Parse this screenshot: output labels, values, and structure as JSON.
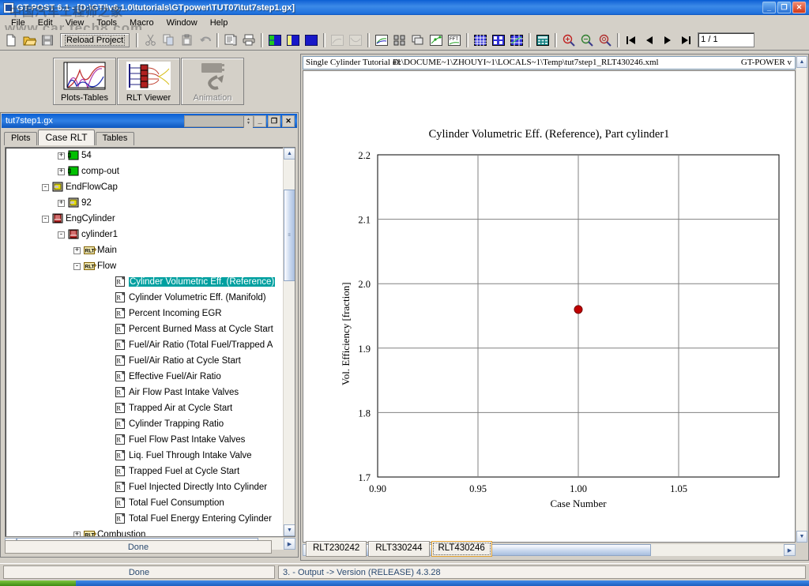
{
  "window": {
    "title": "GT-POST 6.1 - [D:\\GTI\\v6.1.0\\tutorials\\GTpower\\TUT07\\tut7step1.gx]",
    "minimize": "_",
    "maximize": "❐",
    "close": "✕",
    "icon": "app-icon"
  },
  "watermark": {
    "line1": "中国汽车工程师之家",
    "line2": "www.car tech8.com"
  },
  "menu": [
    "File",
    "Edit",
    "View",
    "Tools",
    "Macro",
    "Window",
    "Help"
  ],
  "toolbar": {
    "reload_label": "Reload Project",
    "page_value": "1 / 1",
    "icons": [
      "new-file-icon",
      "open-folder-icon",
      "save-icon",
      "cut-icon",
      "copy-icon",
      "paste-icon",
      "undo-icon",
      "print-preview-icon",
      "print-icon",
      "layout-2x-icon",
      "layout-split-icon",
      "layout-full-icon",
      "plot-disabled-icon",
      "curve-disabled-icon",
      "plot-icon",
      "thumbnails-icon",
      "cascade-icon",
      "xy-plot-icon",
      "fft-icon",
      "table-grid-icon",
      "table-cells-icon",
      "table-plot-icon",
      "calc-icon",
      "zoom-in-icon",
      "zoom-out-icon",
      "zoom-reset-icon",
      "first-page-icon",
      "prev-page-icon",
      "next-page-icon",
      "last-page-icon"
    ]
  },
  "modes": [
    {
      "label": "Plots-Tables",
      "icon": "plots-tables-icon",
      "enabled": true
    },
    {
      "label": "RLT Viewer",
      "icon": "rlt-viewer-icon",
      "enabled": true
    },
    {
      "label": "Animation",
      "icon": "animation-icon",
      "enabled": false
    }
  ],
  "child_window": {
    "title": "tut7step1.gx",
    "minimize": "_",
    "maximize": "❐",
    "close": "✕",
    "tabs": [
      {
        "label": "Plots",
        "active": false
      },
      {
        "label": "Case RLT",
        "active": true
      },
      {
        "label": "Tables",
        "active": false
      }
    ],
    "status": "Done"
  },
  "tree": [
    {
      "indent": 3,
      "toggle": "+",
      "icon": "green-block-icon",
      "label": "54",
      "selected": false
    },
    {
      "indent": 3,
      "toggle": "+",
      "icon": "green-block-icon",
      "label": "comp-out",
      "selected": false
    },
    {
      "indent": 2,
      "toggle": "-",
      "icon": "yellow-cap-icon",
      "label": "EndFlowCap",
      "selected": false
    },
    {
      "indent": 3,
      "toggle": "+",
      "icon": "yellow-cap-icon",
      "label": "92",
      "selected": false
    },
    {
      "indent": 2,
      "toggle": "-",
      "icon": "cylinder-icon",
      "label": "EngCylinder",
      "selected": false
    },
    {
      "indent": 3,
      "toggle": "-",
      "icon": "cylinder-icon",
      "label": "cylinder1",
      "selected": false
    },
    {
      "indent": 4,
      "toggle": "+",
      "icon": "rlt-folder-icon",
      "label": "Main",
      "selected": false
    },
    {
      "indent": 4,
      "toggle": "-",
      "icon": "rlt-folder-icon",
      "label": "Flow",
      "selected": false
    },
    {
      "indent": 6,
      "toggle": "",
      "icon": "rlt-item-icon",
      "label": "Cylinder Volumetric Eff. (Reference)",
      "selected": true
    },
    {
      "indent": 6,
      "toggle": "",
      "icon": "rlt-item-icon",
      "label": "Cylinder Volumetric Eff. (Manifold)",
      "selected": false
    },
    {
      "indent": 6,
      "toggle": "",
      "icon": "rlt-item-icon",
      "label": "Percent Incoming EGR",
      "selected": false
    },
    {
      "indent": 6,
      "toggle": "",
      "icon": "rlt-item-icon",
      "label": "Percent Burned Mass at Cycle Start",
      "selected": false
    },
    {
      "indent": 6,
      "toggle": "",
      "icon": "rlt-item-icon",
      "label": "Fuel/Air Ratio (Total Fuel/Trapped A",
      "selected": false
    },
    {
      "indent": 6,
      "toggle": "",
      "icon": "rlt-item-icon",
      "label": "Fuel/Air Ratio at Cycle Start",
      "selected": false
    },
    {
      "indent": 6,
      "toggle": "",
      "icon": "rlt-item-icon",
      "label": "Effective Fuel/Air Ratio",
      "selected": false
    },
    {
      "indent": 6,
      "toggle": "",
      "icon": "rlt-item-icon",
      "label": "Air Flow Past Intake Valves",
      "selected": false
    },
    {
      "indent": 6,
      "toggle": "",
      "icon": "rlt-item-icon",
      "label": "Trapped Air at Cycle Start",
      "selected": false
    },
    {
      "indent": 6,
      "toggle": "",
      "icon": "rlt-item-icon",
      "label": "Cylinder Trapping Ratio",
      "selected": false
    },
    {
      "indent": 6,
      "toggle": "",
      "icon": "rlt-item-icon",
      "label": "Fuel Flow Past Intake Valves",
      "selected": false
    },
    {
      "indent": 6,
      "toggle": "",
      "icon": "rlt-item-icon",
      "label": "Liq. Fuel Through Intake Valve",
      "selected": false
    },
    {
      "indent": 6,
      "toggle": "",
      "icon": "rlt-item-icon",
      "label": "Trapped Fuel at Cycle Start",
      "selected": false
    },
    {
      "indent": 6,
      "toggle": "",
      "icon": "rlt-item-icon",
      "label": "Fuel Injected Directly Into Cylinder",
      "selected": false
    },
    {
      "indent": 6,
      "toggle": "",
      "icon": "rlt-item-icon",
      "label": "Total Fuel Consumption",
      "selected": false
    },
    {
      "indent": 6,
      "toggle": "",
      "icon": "rlt-item-icon",
      "label": "Total Fuel Energy Entering Cylinder",
      "selected": false
    },
    {
      "indent": 4,
      "toggle": "+",
      "icon": "rlt-folder-icon",
      "label": "Combustion",
      "selected": false
    }
  ],
  "plot_window": {
    "header_left": "Single Cylinder Tutorial #1",
    "header_path": "D:\\DOCUME~1\\ZHOUYI~1\\LOCALS~1\\Temp\\tut7step1_RLT430246.xml",
    "header_right": "GT-POWER v",
    "tabs": [
      {
        "label": "RLT230242",
        "active": false
      },
      {
        "label": "RLT330244",
        "active": false
      },
      {
        "label": "RLT430246",
        "active": true
      }
    ]
  },
  "chart_data": {
    "type": "scatter",
    "title": "Cylinder Volumetric Eff. (Reference), Part cylinder1",
    "xlabel": "Case Number",
    "ylabel": "Vol. Efficiency [fraction]",
    "xlim": [
      0.9,
      1.1
    ],
    "ylim": [
      1.7,
      2.2
    ],
    "xticks": [
      "0.90",
      "0.95",
      "1.00",
      "1.05"
    ],
    "xtick_values": [
      0.9,
      0.95,
      1.0,
      1.05
    ],
    "yticks": [
      "1.7",
      "1.8",
      "1.9",
      "2.0",
      "2.1",
      "2.2"
    ],
    "ytick_values": [
      1.7,
      1.8,
      1.9,
      2.0,
      2.1,
      2.2
    ],
    "grid": true,
    "legend": "none",
    "series": [
      {
        "name": "cylinder1",
        "color": "#c00000",
        "x": [
          1.0
        ],
        "y": [
          1.96
        ]
      }
    ]
  },
  "statusbar": {
    "left_text": "Done",
    "right_text": "3. - Output -> Version (RELEASE) 4.3.28"
  }
}
